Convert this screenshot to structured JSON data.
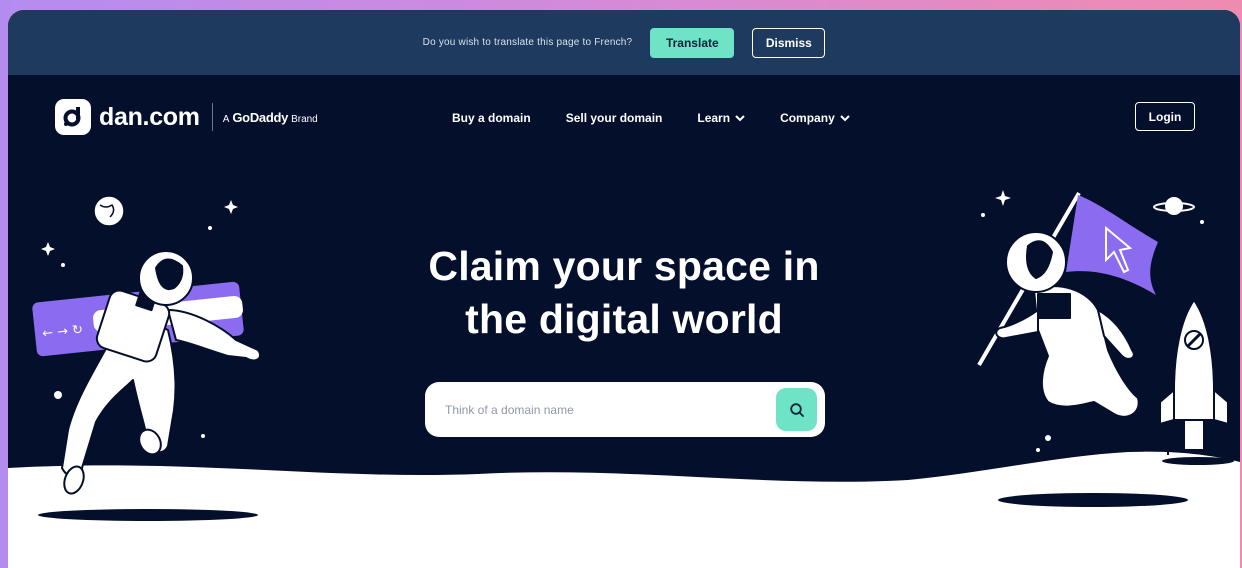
{
  "translate_bar": {
    "message": "Do you wish to translate this page to French?",
    "translate_label": "Translate",
    "dismiss_label": "Dismiss"
  },
  "header": {
    "logo_text": "dan.com",
    "brand_prefix": "A",
    "brand_name": "GoDaddy",
    "brand_suffix": "Brand",
    "nav": [
      {
        "label": "Buy a domain"
      },
      {
        "label": "Sell your domain"
      },
      {
        "label": "Learn",
        "icon": "chevron-down-icon"
      },
      {
        "label": "Company",
        "icon": "chevron-down-icon"
      }
    ],
    "login_label": "Login"
  },
  "hero": {
    "title_line1": "Claim your space in",
    "title_line2": "the digital world",
    "search_placeholder": "Think of a domain name",
    "search_icon": "search-icon"
  },
  "colors": {
    "page_bg": "#030f2b",
    "translate_bar_bg": "#1e3a5f",
    "accent": "#6fe3c6",
    "illustration_purple": "#8b6cf0"
  }
}
